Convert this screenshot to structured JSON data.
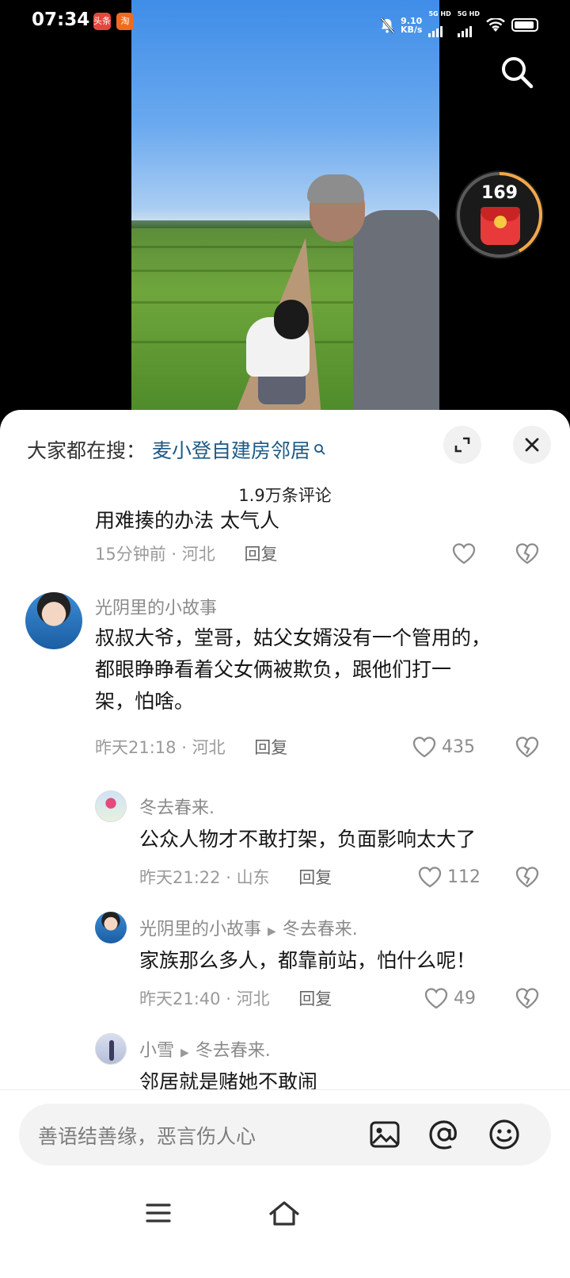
{
  "status_bar": {
    "time": "07:34",
    "app_badge_1": "头条",
    "app_badge_2": "淘",
    "net_speed_value": "9.10",
    "net_speed_unit": "KB/s",
    "sig1_label": "5G HD",
    "sig2_label": "5G HD"
  },
  "redpacket": {
    "count": "169",
    "progress": 0.42
  },
  "hot_search": {
    "label": "大家都在搜：",
    "query": "麦小登自建房邻居"
  },
  "comment_count": "1.9万条评论",
  "comments": [
    {
      "text": "用难揍的办法 太气人",
      "time": "15分钟前",
      "location": "河北",
      "reply_label": "回复",
      "likes": ""
    },
    {
      "user": "光阴里的小故事",
      "text_lines": [
        "叔叔大爷，堂哥，姑父女婿没有一个管用的，",
        "都眼睁睁看着父女俩被欺负，跟他们打一",
        "架，怕啥。"
      ],
      "time": "昨天21:18",
      "location": "河北",
      "reply_label": "回复",
      "likes": "435"
    },
    {
      "user": "冬去春来.",
      "text": "公众人物才不敢打架，负面影响太大了",
      "time": "昨天21:22",
      "location": "山东",
      "reply_label": "回复",
      "likes": "112"
    },
    {
      "user": "光阴里的小故事",
      "reply_to": "冬去春来.",
      "text": "家族那么多人，都靠前站，怕什么呢！",
      "time": "昨天21:40",
      "location": "河北",
      "reply_label": "回复",
      "likes": "49"
    },
    {
      "user": "小雪",
      "reply_to": "冬去春来.",
      "text": "邻居就是赌她不敢闹"
    }
  ],
  "input": {
    "placeholder": "善语结善缘，恶言伤人心"
  },
  "icons": {
    "search": "search-icon",
    "expand": "expand-icon",
    "close": "close-icon",
    "like": "heart-icon",
    "dislike": "broken-heart-icon",
    "image": "image-icon",
    "mention": "at-icon",
    "emoji": "emoji-icon",
    "menu": "menu-icon",
    "home": "home-icon"
  }
}
